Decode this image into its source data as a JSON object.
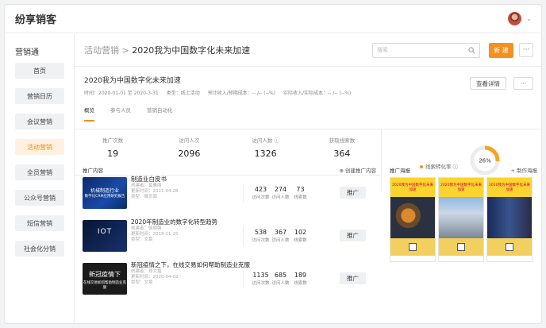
{
  "app": {
    "title": "纷享销客"
  },
  "sidebar": {
    "title": "营销通",
    "items": [
      {
        "label": "首页"
      },
      {
        "label": "营销日历"
      },
      {
        "label": "会议营销"
      },
      {
        "label": "活动营销",
        "active": true
      },
      {
        "label": "全员营销"
      },
      {
        "label": "公众号营销"
      },
      {
        "label": "短信营销"
      },
      {
        "label": "社会化分销"
      }
    ]
  },
  "header": {
    "breadcrumb_parent": "活动营销",
    "breadcrumb_sep": ">",
    "breadcrumb_current": "2020我为中国数字化未来加速",
    "search_placeholder": "搜索",
    "new_label": "新 建",
    "more_label": "···"
  },
  "campaign": {
    "title": "2020我为中国数字化未来加速",
    "time": "时间：2020-01-01 至 2020-3-31",
    "type": "类型：线上活动",
    "expected": "预计收入/预期成本：-- /-- (--%)",
    "actual": "实际收入/实际成本：-- /-- (--%)",
    "detail_label": "查看详情",
    "more_label": "···",
    "tabs": [
      {
        "label": "概览",
        "active": true
      },
      {
        "label": "参与人员"
      },
      {
        "label": "营销自动化"
      }
    ]
  },
  "stats": [
    {
      "label": "推广次数",
      "value": "19"
    },
    {
      "label": "访问人次",
      "value": "2096"
    },
    {
      "label": "访问人数 ⓘ",
      "value": "1326"
    },
    {
      "label": "获取线索数",
      "value": "364"
    }
  ],
  "conversion": {
    "label": "线索转化率 ⓘ",
    "percent": 26,
    "percent_text": "26%",
    "color": "#f5a524"
  },
  "promo": {
    "title": "推广内容",
    "create_link": "⊕ 创建推广内容",
    "col_labels": [
      "访问次数",
      "访问人数",
      "线索数"
    ],
    "push_label": "推广",
    "items": [
      {
        "title": "制造业白皮书",
        "creator": "创建者：莫雅丽",
        "updated": "更新时间：2021-04-28",
        "kind": "类型：微页面",
        "thumb_text": "机械制造行业",
        "thumb_sub": "数字化CRM应用研究报告",
        "visits": "423",
        "visitors": "274",
        "leads": "73"
      },
      {
        "title": "2020年制造业的数字化转型趋势",
        "creator": "创建者：徐顺强",
        "updated": "更新时间：2019-11-25",
        "kind": "类型：文章",
        "thumb_text": "IOT",
        "thumb_sub": "",
        "visits": "538",
        "visitors": "367",
        "leads": "102"
      },
      {
        "title": "新冠疫情之下，在线交易如何帮助制造业克服",
        "creator": "创建者：郑文嘉",
        "updated": "更新时间：2020-04-02",
        "kind": "类型：文章",
        "thumb_text": "新冠疫情下",
        "thumb_sub": "在线交易如何帮助制造业克服",
        "visits": "1135",
        "visitors": "685",
        "leads": "189"
      }
    ]
  },
  "posters": {
    "title": "推广海报",
    "create_link": "+ 制作海报",
    "items": [
      {
        "band": "2020我为中国数字化未来加速"
      },
      {
        "band": "2020我为中国数字化未来加速"
      },
      {
        "band": "2020我为中国数字化未来加速"
      }
    ]
  }
}
